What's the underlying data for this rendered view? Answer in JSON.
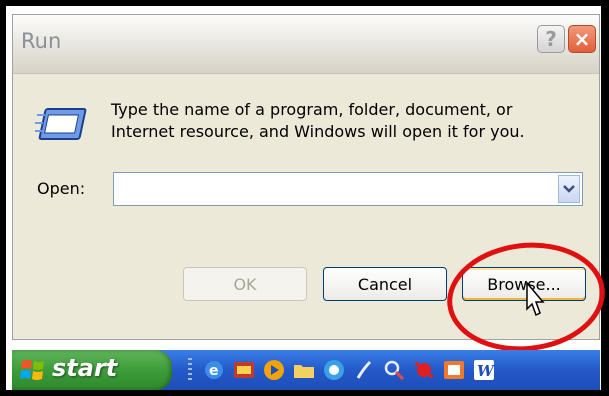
{
  "dialog": {
    "title": "Run",
    "help_label": "?",
    "close_label": "×",
    "description_line1": "Type the name of a program, folder, document, or",
    "description_line2": "Internet resource, and Windows will open it for you.",
    "open_label": "Open:",
    "open_value": "",
    "ok_label": "OK",
    "cancel_label": "Cancel",
    "browse_label": "Browse..."
  },
  "taskbar": {
    "start_label": "start",
    "quick_launch": [
      "internet-explorer-icon",
      "tools-icon",
      "media-player-icon",
      "folder-icon",
      "messenger-icon",
      "feather-icon",
      "search-icon",
      "splat-icon",
      "media-icon",
      "word-icon"
    ]
  },
  "colors": {
    "dialog_bg": "#ece9d8",
    "close_button": "#e0603a",
    "taskbar_blue": "#2459c8",
    "start_green": "#3b9a38",
    "highlight_red": "#e01010"
  }
}
